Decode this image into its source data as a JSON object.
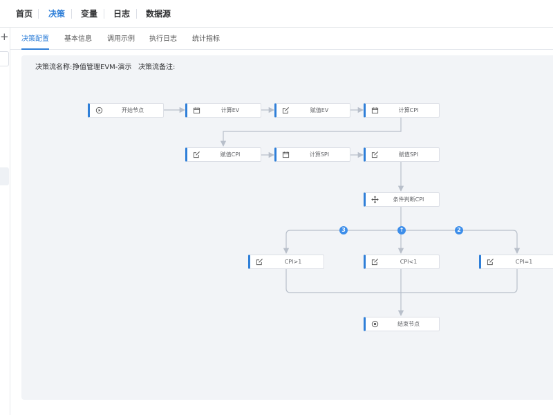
{
  "nav": {
    "items": [
      "首页",
      "决策",
      "变量",
      "日志",
      "数据源"
    ],
    "active_index": 1
  },
  "sidebar": {
    "add_symbol": "+"
  },
  "tabs": [
    "决策配置",
    "基本信息",
    "调用示例",
    "执行日志",
    "统计指标"
  ],
  "info": {
    "name_label": "决策流名称:",
    "name_value": "挣值管理EVM-演示",
    "remark_label": "决策流备注:"
  },
  "flow": {
    "nodes": {
      "start": {
        "label": "开始节点",
        "icon": "play-circle-icon"
      },
      "calc_ev": {
        "label": "计算EV",
        "icon": "calendar-icon"
      },
      "assign_ev": {
        "label": "赋值EV",
        "icon": "edit-icon"
      },
      "calc_cpi": {
        "label": "计算CPI",
        "icon": "calendar-icon"
      },
      "assign_cpi": {
        "label": "赋值CPI",
        "icon": "edit-icon"
      },
      "calc_spi": {
        "label": "计算SPI",
        "icon": "calendar-icon"
      },
      "assign_spi": {
        "label": "赋值SPI",
        "icon": "edit-icon"
      },
      "cond_cpi": {
        "label": "条件判断CPI",
        "icon": "move-icon"
      },
      "cpi_gt": {
        "label": "CPI>1",
        "icon": "edit-icon"
      },
      "cpi_lt": {
        "label": "CPI<1",
        "icon": "edit-icon"
      },
      "cpi_eq": {
        "label": "CPI=1",
        "icon": "edit-icon"
      },
      "end": {
        "label": "结束节点",
        "icon": "stop-circle-icon"
      }
    },
    "branches": {
      "left": "3",
      "middle": "↑",
      "right": "2"
    }
  },
  "colors": {
    "accent": "#2f7fd8",
    "canvas_bg": "#f2f4f7",
    "edge": "#b8bfca",
    "badge": "#3d8eea"
  }
}
